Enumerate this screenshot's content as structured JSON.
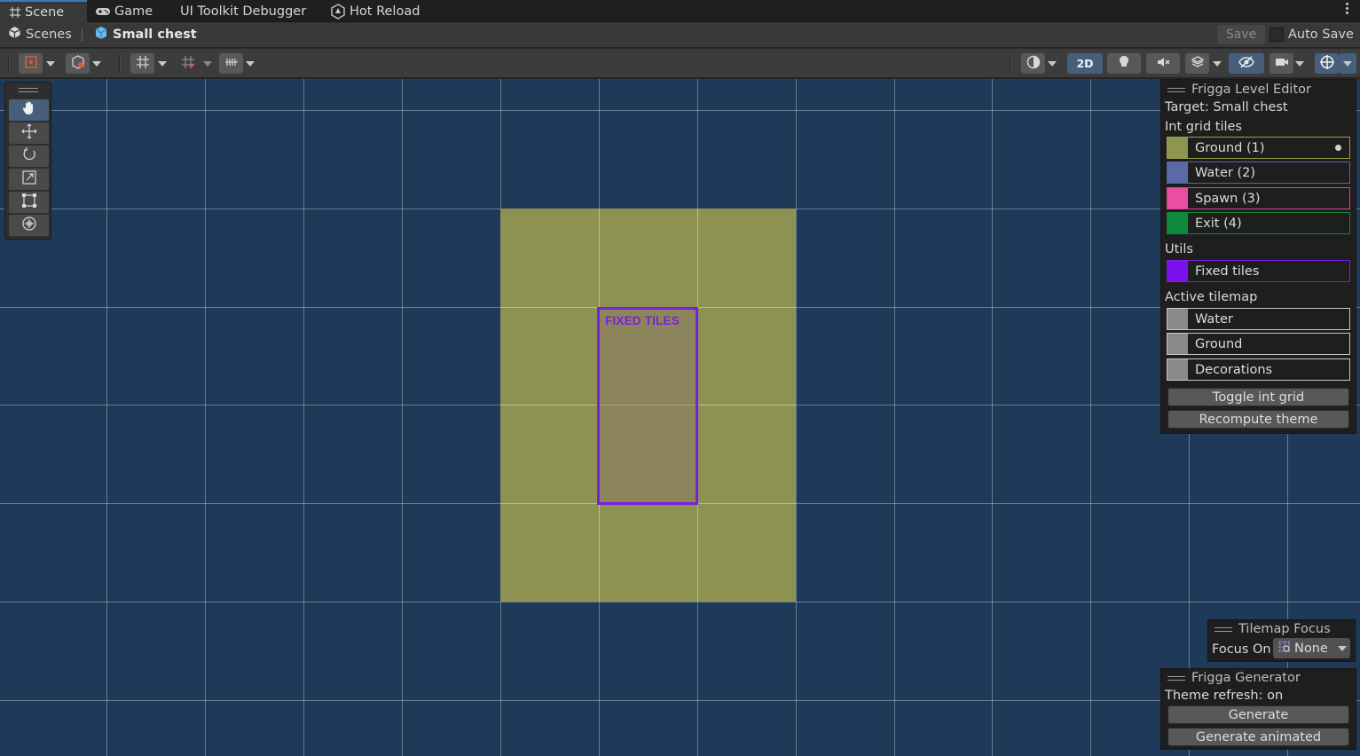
{
  "tabs": [
    {
      "label": "Scene",
      "icon": "grid-hash-icon",
      "active": true
    },
    {
      "label": "Game",
      "icon": "gamepad-icon",
      "active": false
    },
    {
      "label": "UI Toolkit Debugger",
      "icon": "",
      "active": false
    },
    {
      "label": "Hot Reload",
      "icon": "hot-reload-icon",
      "active": false
    }
  ],
  "breadcrumb": {
    "root": "Scenes",
    "current": "Small chest"
  },
  "save_label": "Save",
  "auto_save_label": "Auto Save",
  "toolbar": {
    "two_d_label": "2D"
  },
  "scene": {
    "fixed_tiles_label": "FIXED TILES",
    "colors": {
      "background": "#1f3a58",
      "ground": "#8d9252",
      "fixed": "#7a1fe0"
    }
  },
  "level_editor": {
    "title": "Frigga Level Editor",
    "target": "Target: Small chest",
    "int_grid_heading": "Int grid tiles",
    "int_grid_tiles": [
      {
        "label": "Ground (1)",
        "color": "#8f944f",
        "border": "#9aa24a",
        "selected": true
      },
      {
        "label": "Water (2)",
        "color": "#5a6aa8",
        "border": "#4f66b0",
        "selected": false
      },
      {
        "label": "Spawn (3)",
        "color": "#e84fa3",
        "border": "#e0418f",
        "selected": false
      },
      {
        "label": "Exit (4)",
        "color": "#0e8a3c",
        "border": "#12843a",
        "selected": false
      }
    ],
    "utils_heading": "Utils",
    "utils": [
      {
        "label": "Fixed tiles",
        "color": "#7a10ec",
        "border": "#7a1fe0"
      }
    ],
    "active_tilemap_heading": "Active tilemap",
    "tilemaps": [
      {
        "label": "Water",
        "color": "#8a8a8a",
        "border": "#c8c8c8"
      },
      {
        "label": "Ground",
        "color": "#8a8a8a",
        "border": "#c8c8c8"
      },
      {
        "label": "Decorations",
        "color": "#8a8a8a",
        "border": "#c8c8c8"
      }
    ],
    "toggle_button": "Toggle int grid",
    "recompute_button": "Recompute theme"
  },
  "tilemap_focus": {
    "title": "Tilemap Focus",
    "focus_on_label": "Focus On",
    "focus_value": "None"
  },
  "generator": {
    "title": "Frigga Generator",
    "status": "Theme refresh: on",
    "generate_button": "Generate",
    "generate_animated_button": "Generate animated"
  }
}
